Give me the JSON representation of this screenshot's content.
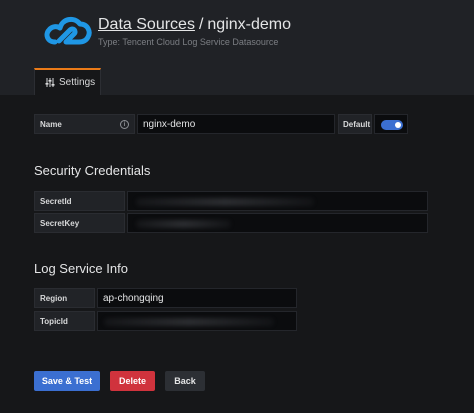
{
  "header": {
    "title_crumb": "Data Sources",
    "title_separator": "/",
    "title_name": "nginx-demo",
    "subtitle": "Type: Tencent Cloud Log Service Datasource",
    "logo_icon": "tencent-cloud-logo-icon",
    "logo_color": "#1f97e5"
  },
  "tabs": [
    {
      "label": "Settings",
      "icon": "sliders-icon",
      "active": true
    }
  ],
  "name_row": {
    "label": "Name",
    "value": "nginx-demo",
    "default_label": "Default",
    "default_on": true
  },
  "security": {
    "title": "Security Credentials",
    "fields": [
      {
        "label": "SecretId",
        "value": ""
      },
      {
        "label": "SecretKey",
        "value": ""
      }
    ]
  },
  "log_service": {
    "title": "Log Service Info",
    "fields": [
      {
        "label": "Region",
        "value": "ap-chongqing"
      },
      {
        "label": "TopicId",
        "value": ""
      }
    ]
  },
  "buttons": {
    "save": "Save & Test",
    "delete": "Delete",
    "back": "Back"
  },
  "colors": {
    "accent_blue": "#3b6fd1",
    "danger_red": "#d0333d",
    "tab_orange": "#eb7b18"
  }
}
